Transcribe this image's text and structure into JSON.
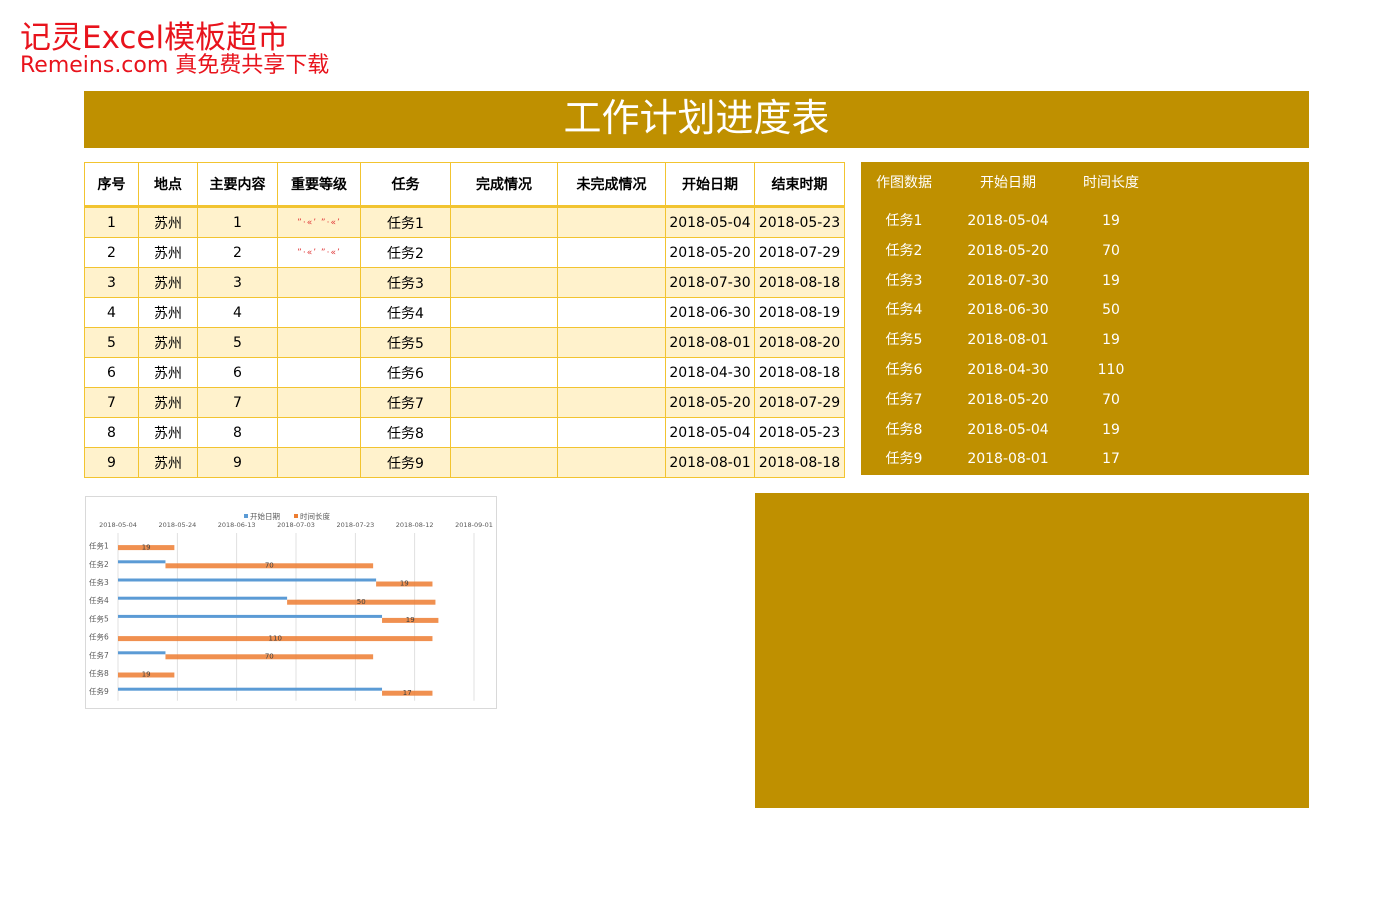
{
  "watermark": {
    "line1": "记灵Excel模板超市",
    "line2": "Remeins.com 真免费共享下载"
  },
  "title": "工作计划进度表",
  "colors": {
    "gold": "#bf9000",
    "row_alt": "#fff2cc",
    "border": "#f2c430",
    "watermark": "#e8131c",
    "start_series": "#5b9bd5",
    "duration_series": "#ed7d31"
  },
  "table": {
    "headers": [
      "序号",
      "地点",
      "主要内容",
      "重要等级",
      "任务",
      "完成情况",
      "未完成情况",
      "开始日期",
      "结束时期"
    ],
    "rows": [
      {
        "no": "1",
        "place": "苏州",
        "content": "1",
        "level": "”·«’   ”·«’",
        "task": "任务1",
        "done": "",
        "undone": "",
        "start": "2018-05-04",
        "end": "2018-05-23"
      },
      {
        "no": "2",
        "place": "苏州",
        "content": "2",
        "level": "”·«’   ”·«’",
        "task": "任务2",
        "done": "",
        "undone": "",
        "start": "2018-05-20",
        "end": "2018-07-29"
      },
      {
        "no": "3",
        "place": "苏州",
        "content": "3",
        "level": "",
        "task": "任务3",
        "done": "",
        "undone": "",
        "start": "2018-07-30",
        "end": "2018-08-18"
      },
      {
        "no": "4",
        "place": "苏州",
        "content": "4",
        "level": "",
        "task": "任务4",
        "done": "",
        "undone": "",
        "start": "2018-06-30",
        "end": "2018-08-19"
      },
      {
        "no": "5",
        "place": "苏州",
        "content": "5",
        "level": "",
        "task": "任务5",
        "done": "",
        "undone": "",
        "start": "2018-08-01",
        "end": "2018-08-20"
      },
      {
        "no": "6",
        "place": "苏州",
        "content": "6",
        "level": "",
        "task": "任务6",
        "done": "",
        "undone": "",
        "start": "2018-04-30",
        "end": "2018-08-18"
      },
      {
        "no": "7",
        "place": "苏州",
        "content": "7",
        "level": "",
        "task": "任务7",
        "done": "",
        "undone": "",
        "start": "2018-05-20",
        "end": "2018-07-29"
      },
      {
        "no": "8",
        "place": "苏州",
        "content": "8",
        "level": "",
        "task": "任务8",
        "done": "",
        "undone": "",
        "start": "2018-05-04",
        "end": "2018-05-23"
      },
      {
        "no": "9",
        "place": "苏州",
        "content": "9",
        "level": "",
        "task": "任务9",
        "done": "",
        "undone": "",
        "start": "2018-08-01",
        "end": "2018-08-18"
      }
    ]
  },
  "side_table": {
    "headers": [
      "作图数据",
      "开始日期",
      "时间长度"
    ],
    "rows": [
      {
        "task": "任务1",
        "start": "2018-05-04",
        "dur": "19"
      },
      {
        "task": "任务2",
        "start": "2018-05-20",
        "dur": "70"
      },
      {
        "task": "任务3",
        "start": "2018-07-30",
        "dur": "19"
      },
      {
        "task": "任务4",
        "start": "2018-06-30",
        "dur": "50"
      },
      {
        "task": "任务5",
        "start": "2018-08-01",
        "dur": "19"
      },
      {
        "task": "任务6",
        "start": "2018-04-30",
        "dur": "110"
      },
      {
        "task": "任务7",
        "start": "2018-05-20",
        "dur": "70"
      },
      {
        "task": "任务8",
        "start": "2018-05-04",
        "dur": "19"
      },
      {
        "task": "任务9",
        "start": "2018-08-01",
        "dur": "17"
      }
    ]
  },
  "chart_data": {
    "type": "bar",
    "orientation": "horizontal",
    "stacked": true,
    "legend": [
      "开始日期",
      "时间长度"
    ],
    "legend_position": "top",
    "x_ticks": [
      "2018-05-04",
      "2018-05-24",
      "2018-06-13",
      "2018-07-03",
      "2018-07-23",
      "2018-08-12",
      "2018-09-01"
    ],
    "xlim": [
      "2018-05-04",
      "2018-09-01"
    ],
    "grid": true,
    "categories": [
      "任务1",
      "任务2",
      "任务3",
      "任务4",
      "任务5",
      "任务6",
      "任务7",
      "任务8",
      "任务9"
    ],
    "series": [
      {
        "name": "开始日期",
        "values": [
          "2018-05-04",
          "2018-05-20",
          "2018-07-30",
          "2018-06-30",
          "2018-08-01",
          "2018-04-30",
          "2018-05-20",
          "2018-05-04",
          "2018-08-01"
        ]
      },
      {
        "name": "时间长度",
        "values": [
          19,
          70,
          19,
          50,
          19,
          110,
          70,
          19,
          17
        ]
      }
    ],
    "data_labels": [
      "19",
      "70",
      "19",
      "50",
      "19",
      "110",
      "70",
      "19",
      "17"
    ]
  }
}
